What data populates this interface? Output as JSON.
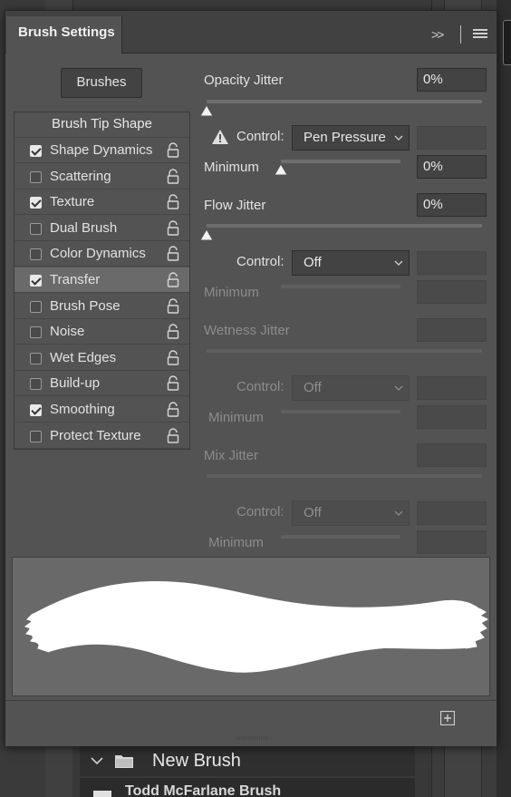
{
  "panel": {
    "tab_label": "Brush Settings",
    "collapse_glyph": ">>",
    "brushes_button": "Brushes"
  },
  "list": {
    "header": "Brush Tip Shape",
    "items": [
      {
        "label": "Shape Dynamics",
        "checked": true,
        "selected": false
      },
      {
        "label": "Scattering",
        "checked": false,
        "selected": false
      },
      {
        "label": "Texture",
        "checked": true,
        "selected": false
      },
      {
        "label": "Dual Brush",
        "checked": false,
        "selected": false
      },
      {
        "label": "Color Dynamics",
        "checked": false,
        "selected": false
      },
      {
        "label": "Transfer",
        "checked": true,
        "selected": true
      },
      {
        "label": "Brush Pose",
        "checked": false,
        "selected": false
      },
      {
        "label": "Noise",
        "checked": false,
        "selected": false
      },
      {
        "label": "Wet Edges",
        "checked": false,
        "selected": false
      },
      {
        "label": "Build-up",
        "checked": false,
        "selected": false
      },
      {
        "label": "Smoothing",
        "checked": true,
        "selected": false
      },
      {
        "label": "Protect Texture",
        "checked": false,
        "selected": false
      }
    ]
  },
  "settings": {
    "opacity_jitter": {
      "label": "Opacity Jitter",
      "value": "0%"
    },
    "opacity_control": {
      "label": "Control:",
      "value": "Pen Pressure"
    },
    "opacity_minimum": {
      "label": "Minimum",
      "value": "0%"
    },
    "flow_jitter": {
      "label": "Flow Jitter",
      "value": "0%"
    },
    "flow_control": {
      "label": "Control:",
      "value": "Off"
    },
    "flow_minimum": {
      "label": "Minimum"
    },
    "wetness_jitter": {
      "label": "Wetness Jitter"
    },
    "wetness_control": {
      "label": "Control:",
      "value": "Off"
    },
    "wetness_minimum": {
      "label": "Minimum"
    },
    "mix_jitter": {
      "label": "Mix Jitter"
    },
    "mix_control": {
      "label": "Control:",
      "value": "Off"
    },
    "mix_minimum": {
      "label": "Minimum"
    }
  },
  "layers": {
    "group_name": "New Brush",
    "item_name": "Todd McFarlane Brush"
  },
  "colors": {
    "panel_bg": "#535353",
    "selected_row": "#6a6a6a",
    "preview_bg": "#696969",
    "stroke": "#ffffff"
  }
}
